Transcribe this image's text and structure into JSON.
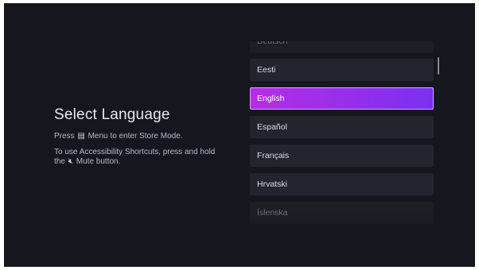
{
  "screen": {
    "title": "Select Language",
    "hint_store_prefix": "Press",
    "menu_icon": "menu-icon",
    "hint_store_suffix": "Menu to enter Store Mode.",
    "hint_access_line1": "To use Accessibility Shortcuts, press and hold",
    "hint_access_prefix": "the",
    "mute_icon": "mute-icon",
    "hint_access_suffix": "Mute button."
  },
  "languages": {
    "items": [
      {
        "label": "Deutsch",
        "state": "partial"
      },
      {
        "label": "Eesti",
        "state": "normal"
      },
      {
        "label": "English",
        "state": "selected"
      },
      {
        "label": "Español",
        "state": "normal"
      },
      {
        "label": "Français",
        "state": "normal"
      },
      {
        "label": "Hrvatski",
        "state": "normal"
      },
      {
        "label": "Íslenska",
        "state": "partial"
      }
    ],
    "selected_index": 2
  },
  "colors": {
    "background": "#16161f",
    "item_background": "#24242e",
    "accent_start": "#b52ee6",
    "accent_end": "#7a30f0"
  }
}
